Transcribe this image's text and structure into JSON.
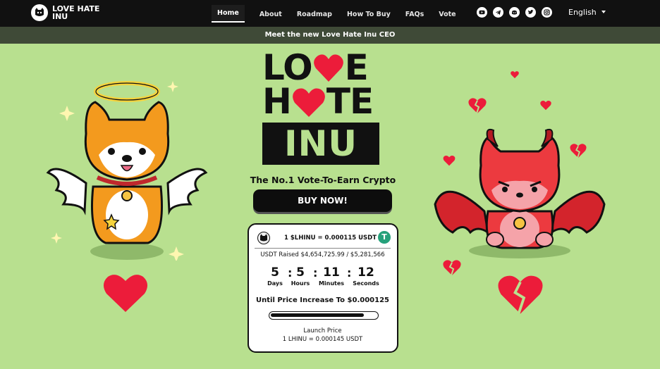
{
  "nav": {
    "brand": "LOVE HATE INU",
    "links": [
      "Home",
      "About",
      "Roadmap",
      "How To Buy",
      "FAQs",
      "Vote"
    ],
    "active": "Home",
    "socials": [
      "youtube-icon",
      "telegram-icon",
      "discord-icon",
      "twitter-icon",
      "instagram-icon"
    ],
    "language": "English"
  },
  "banner": {
    "text": "Meet the new Love Hate Inu CEO"
  },
  "hero": {
    "logo_line1_a": "LO",
    "logo_line1_b": "E",
    "logo_line2_a": "H",
    "logo_line2_b": "TE",
    "logo_line3": "INU",
    "tagline": "The No.1 Vote-To-Earn Crypto",
    "buy_label": "BUY NOW!"
  },
  "presale": {
    "price": "1 $LHINU = 0.000115 USDT",
    "tether_symbol": "T",
    "raised_label": "USDT Raised",
    "raised_value": "$4,654,725.99 / $5,281,566",
    "countdown": [
      {
        "value": "5",
        "label": "Days"
      },
      {
        "value": "5",
        "label": "Hours"
      },
      {
        "value": "11",
        "label": "Minutes"
      },
      {
        "value": "12",
        "label": "Seconds"
      }
    ],
    "next_price": "Until Price Increase To $0.000125",
    "progress": 0.88,
    "launch_label": "Launch Price",
    "launch_value": "1 LHINU = 0.000145 USDT"
  },
  "colors": {
    "background": "#b8e08f",
    "nav": "#111111",
    "banner": "#3f4a37",
    "heart": "#ec1c3a",
    "tether": "#26a17b"
  }
}
